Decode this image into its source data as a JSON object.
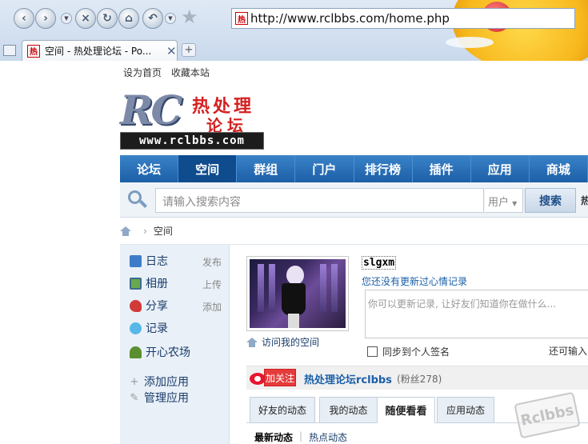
{
  "browser": {
    "url": "http://www.rclbbs.com/home.php",
    "tab_title": "空间 - 热处理论坛 - Po...",
    "favicon_text": "热",
    "new_tab_symbol": "+",
    "close_symbol": "✕"
  },
  "toplinks": [
    "设为首页",
    "收藏本站"
  ],
  "logo": {
    "letters": "RC",
    "cn_line1": "热处理",
    "cn_line2": "论坛",
    "url": "www.rclbbs.com"
  },
  "mainnav": {
    "items": [
      "论坛",
      "空间",
      "群组",
      "门户",
      "排行榜",
      "插件",
      "应用",
      "商城"
    ],
    "active": "空间"
  },
  "search": {
    "placeholder": "请输入搜索内容",
    "type": "用户",
    "button": "搜索",
    "more": "热"
  },
  "breadcrumb": {
    "sep": "›",
    "current": "空间"
  },
  "sidebar": {
    "items": [
      {
        "label": "日志",
        "action": "发布",
        "icon": "log-icon",
        "color": "#3d7cc9"
      },
      {
        "label": "相册",
        "action": "上传",
        "icon": "album-icon",
        "color": "#6aa84f"
      },
      {
        "label": "分享",
        "action": "添加",
        "icon": "share-icon",
        "color": "#d23a3a"
      },
      {
        "label": "记录",
        "action": "",
        "icon": "record-icon",
        "color": "#55b8e8"
      },
      {
        "label": "开心农场",
        "action": "",
        "icon": "farm-icon",
        "color": "#5a8f2f"
      }
    ],
    "add_app": "添加应用",
    "manage_app": "管理应用"
  },
  "profile": {
    "username": "slgxm",
    "mood_link": "您还没有更新过心情记录",
    "mood_placeholder": "你可以更新记录, 让好友们知道你在做什么...",
    "sync_label": "同步到个人签名",
    "remain_label": "还可输入",
    "visit_label": "访问我的空间"
  },
  "follow": {
    "button": "加关注",
    "name": "热处理论坛rclbbs",
    "fans": "(粉丝278)"
  },
  "feed_tabs": [
    "好友的动态",
    "我的动态",
    "随便看看",
    "应用动态"
  ],
  "feed_active": "随便看看",
  "sub_tabs": {
    "active": "最新动态",
    "sep": "|",
    "other": "热点动态"
  },
  "watermark": "Rclbbs"
}
